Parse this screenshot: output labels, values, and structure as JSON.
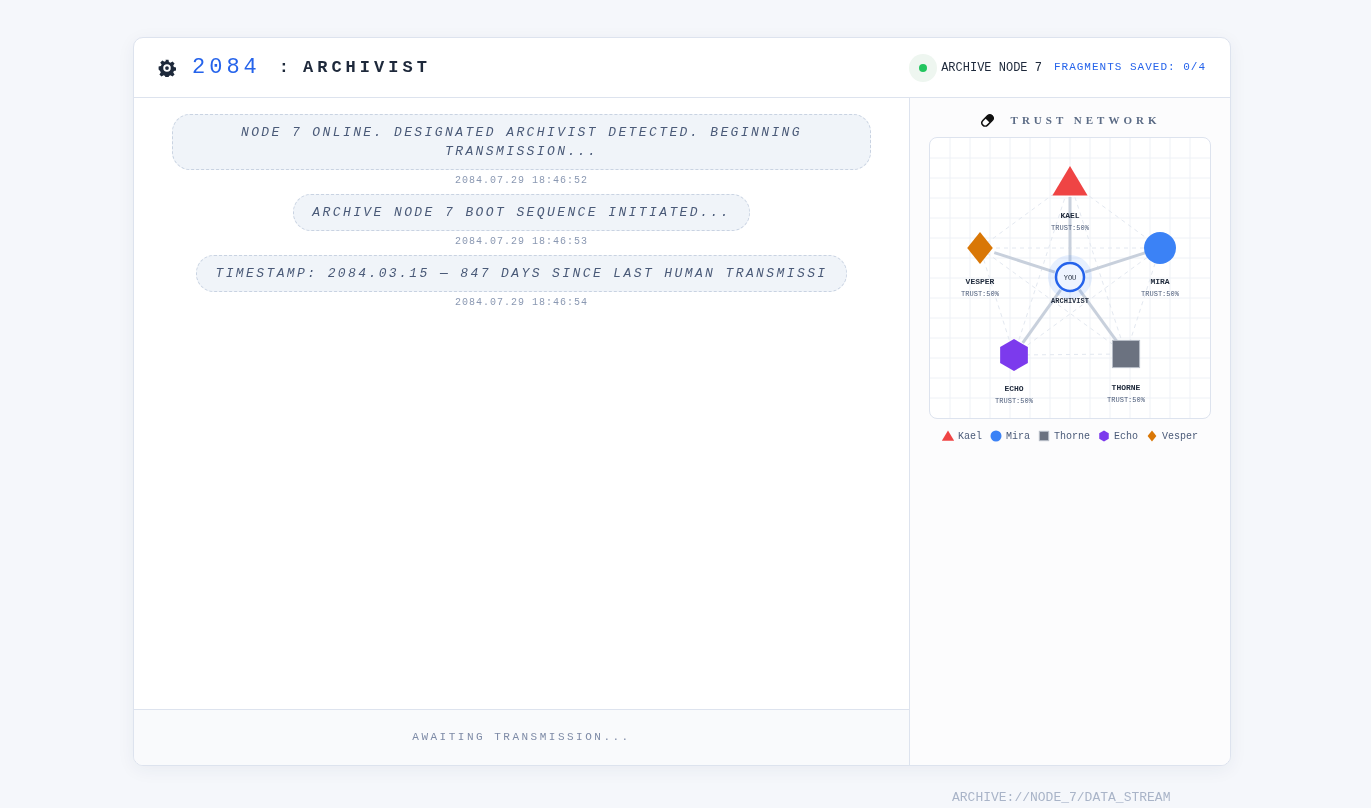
{
  "header": {
    "year": "2084",
    "separator": ":",
    "title": "ARCHIVIST",
    "status": {
      "label": "ARCHIVE NODE 7",
      "online": true,
      "color": "#22c55e"
    },
    "fragments": "FRAGMENTS SAVED: 0/4"
  },
  "messages": [
    {
      "text": "NODE 7 ONLINE. DESIGNATED ARCHIVIST DETECTED. BEGINNING TRANSMISSION...",
      "time": "2084.07.29 18:46:52"
    },
    {
      "text": "ARCHIVE NODE 7 BOOT SEQUENCE INITIATED...",
      "time": "2084.07.29 18:46:53"
    },
    {
      "text": "TIMESTAMP: 2084.03.15 — 847 DAYS SINCE LAST HUMAN TRANSMISSI",
      "time": "2084.07.29 18:46:54"
    }
  ],
  "status_bar": "AWAITING TRANSMISSION...",
  "trust_network": {
    "title": "TRUST NETWORK",
    "center": {
      "label": "YOU",
      "role": "ARCHIVIST"
    },
    "nodes": [
      {
        "name": "KAEL",
        "trust": "TRUST:50%",
        "kind": "triangle",
        "color": "#ef4444"
      },
      {
        "name": "VESPER",
        "trust": "TRUST:50%",
        "kind": "diamond",
        "color": "#d97706"
      },
      {
        "name": "MIRA",
        "trust": "TRUST:50%",
        "kind": "circle",
        "color": "#3b82f6"
      },
      {
        "name": "ECHO",
        "trust": "TRUST:50%",
        "kind": "hexagon",
        "color": "#7c3aed"
      },
      {
        "name": "THORNE",
        "trust": "TRUST:50%",
        "kind": "square",
        "color": "#6b7280"
      }
    ],
    "legend": [
      {
        "label": "Kael",
        "kind": "triangle",
        "color": "#ef4444"
      },
      {
        "label": "Mira",
        "kind": "circle",
        "color": "#3b82f6"
      },
      {
        "label": "Thorne",
        "kind": "square",
        "color": "#6b7280"
      },
      {
        "label": "Echo",
        "kind": "hexagon",
        "color": "#7c3aed"
      },
      {
        "label": "Vesper",
        "kind": "diamond",
        "color": "#d97706"
      }
    ]
  },
  "background_text": "ARCHIVE://NODE_7/DATA_STREAM"
}
